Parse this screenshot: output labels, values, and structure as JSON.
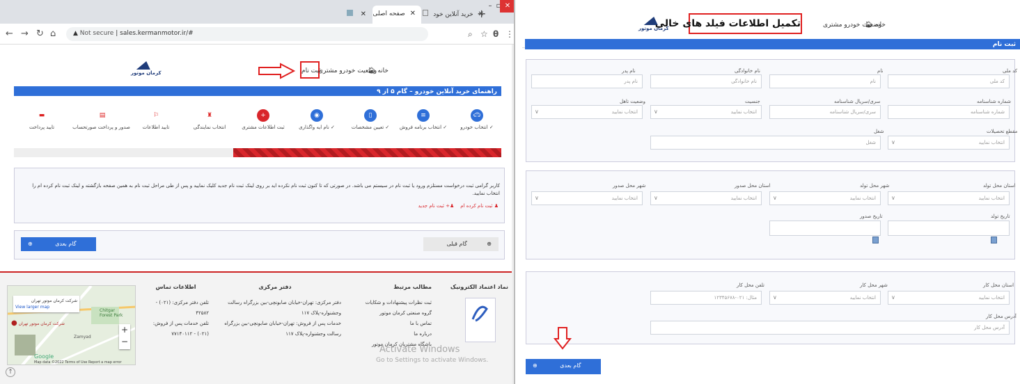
{
  "browser": {
    "tabs": [
      {
        "label": "خرید آنلاین خود",
        "active": false
      },
      {
        "label": "صفحه اصلی",
        "active": true
      },
      {
        "label": "",
        "active": false
      }
    ],
    "url": "sales.kermanmotor.ir/#",
    "security": "Not secure"
  },
  "left_page": {
    "logo_text": "کرمان موتور",
    "nav": {
      "home": "خانه",
      "status": "وضعیت خودرو مشتری",
      "register": "ثبت نام"
    },
    "guide_bar": "راهنمای خرید آنلاین خودرو – گام ۵ از ۹",
    "steps": [
      {
        "label": "انتخاب خودرو",
        "done": true,
        "color": "#2f6fd8",
        "icon": "car-icon"
      },
      {
        "label": "انتخاب برنامه فروش",
        "done": true,
        "color": "#2f6fd8",
        "icon": "list-icon"
      },
      {
        "label": "تعیین مشخصات",
        "done": true,
        "color": "#2f6fd8",
        "icon": "document-icon"
      },
      {
        "label": "نام ایه واگذاری",
        "done": true,
        "color": "#2f6fd8",
        "icon": "eye-icon"
      },
      {
        "label": "ثبت اطلاعات مشتری",
        "done": false,
        "color": "#d9262b",
        "icon": "add-user-icon"
      },
      {
        "label": "انتخاب نمایندگی",
        "done": false,
        "color": "#d9262b",
        "icon": "building-icon"
      },
      {
        "label": "تایید اطلاعات",
        "done": false,
        "color": "#d9262b",
        "icon": "thumb-icon"
      },
      {
        "label": "صدور و پرداخت صورتحساب",
        "done": false,
        "color": "#d9262b",
        "icon": "invoice-icon"
      },
      {
        "label": "تایید پرداخت",
        "done": false,
        "color": "#d9262b",
        "icon": "card-icon"
      }
    ],
    "notice": "کاربر گرامی ثبت درخواست مستلزم ورود یا ثبت نام در سیستم می باشد. در صورتی که تا کنون ثبت نام نکرده اید بر روی لینک ثبت نام جدید کلیک نمایید و پس از طی مراحل ثبت نام به همین صفحه بازگشته و لینک ثبت نام کرده ام را انتخاب نمایید.",
    "links": {
      "registered": "ثبت نام کرده ام",
      "new": "ثبت نام جدید"
    },
    "buttons": {
      "prev": "گام قبلی",
      "next": "گام بعدی"
    },
    "footer": {
      "col1_title": "نماد اعتماد الکترونیک",
      "col2_title": "مطالب مرتبط",
      "col2_items": [
        "ثبت نظرات پیشنهادات و شکایات",
        "گروه صنعتی کرمان موتور",
        "تماس با ما",
        "درباره ما",
        "باشگاه مشتریان کرمان موتور"
      ],
      "col3_title": "دفتر مرکزی",
      "col3_items": [
        "دفتر مرکزی: تهران-خیابان صابونچی-بین بزرگراه رسالت وجشنواره-پلاک ۱۱۷",
        "خدمات پس از فروش: تهران-خیابان صابونچی-بین بزرگراه رسالت وجشنواره-پلاک ۱۱۷"
      ],
      "col4_title": "اطلاعات تماس",
      "col4_rows": [
        {
          "label": "تلفن دفتر مرکزی:",
          "value": "(۰۲۱) - ۴۲۵۸۲"
        },
        {
          "label": "تلفن خدمات پس از فروش:",
          "value": "(۰۲۱) - ۷۷۱۴۰۱۱۲"
        }
      ],
      "map": {
        "title": "شرکت کرمان موتور تهران",
        "link": "View larger map",
        "pin": "شرکت کرمان موتور تهران",
        "places": [
          "Chitgar Forest Park",
          "Zamyad"
        ],
        "brand": "Google",
        "attribution": "Map data ©2022  Terms of Use  Report a map error"
      }
    },
    "watermark": {
      "line1": "Activate Windows",
      "line2": "Go to Settings to activate Windows."
    }
  },
  "right_page": {
    "logo_text": "کرمان موتور",
    "annotation": "تکمیل اطلاعات فیلد های خالی",
    "nav": {
      "home": "خانه",
      "status": "وضعیت خودرو مشتری"
    },
    "section_bar": "ثبت نام",
    "sec1": {
      "row1": [
        {
          "label": "کد ملی",
          "placeholder": "کد ملی"
        },
        {
          "label": "نام",
          "placeholder": "نام"
        },
        {
          "label": "نام خانوادگی",
          "placeholder": "نام خانوادگی"
        },
        {
          "label": "نام پدر",
          "placeholder": "نام پدر"
        }
      ],
      "row2": [
        {
          "label": "شماره شناسنامه",
          "placeholder": "شماره شناسنامه",
          "select": false
        },
        {
          "label": "سری/سریال شناسنامه",
          "placeholder": "سری/سریال شناسنامه",
          "select": false
        },
        {
          "label": "جنسیت",
          "placeholder": "انتخاب نمایید",
          "select": true
        },
        {
          "label": "وضعیت تاهل",
          "placeholder": "انتخاب نمایید",
          "select": true
        }
      ],
      "row3": [
        {
          "label": "مقطع تحصیلات",
          "placeholder": "انتخاب نمایید",
          "select": true
        },
        {
          "label": "شغل",
          "placeholder": "شغل",
          "select": false
        }
      ]
    },
    "sec2": {
      "row1": [
        {
          "label": "استان محل تولد",
          "placeholder": "انتخاب نمایید"
        },
        {
          "label": "شهر محل تولد",
          "placeholder": "انتخاب نمایید"
        },
        {
          "label": "استان محل صدور",
          "placeholder": "انتخاب نمایید"
        },
        {
          "label": "شهر محل صدور",
          "placeholder": "انتخاب نمایید"
        }
      ],
      "row2": [
        {
          "label": "تاریخ تولد",
          "placeholder": ""
        },
        {
          "label": "تاریخ صدور",
          "placeholder": ""
        }
      ]
    },
    "sec3": {
      "row1": [
        {
          "label": "استان محل کار",
          "placeholder": "انتخاب نمایید",
          "select": true
        },
        {
          "label": "شهر محل کار",
          "placeholder": "انتخاب نمایید",
          "select": true
        },
        {
          "label": "تلفن محل کار",
          "placeholder": "مثال: ۰۲۱-۱۲۳۴۵۶۷۸",
          "select": false
        }
      ],
      "address_label": "آدرس محل کار",
      "address_placeholder": "آدرس محل کار"
    },
    "next_button": "گام بعدی"
  },
  "colors": {
    "blue": "#2f6fd8",
    "red": "#d9262b",
    "annotation_red": "#e02020"
  }
}
